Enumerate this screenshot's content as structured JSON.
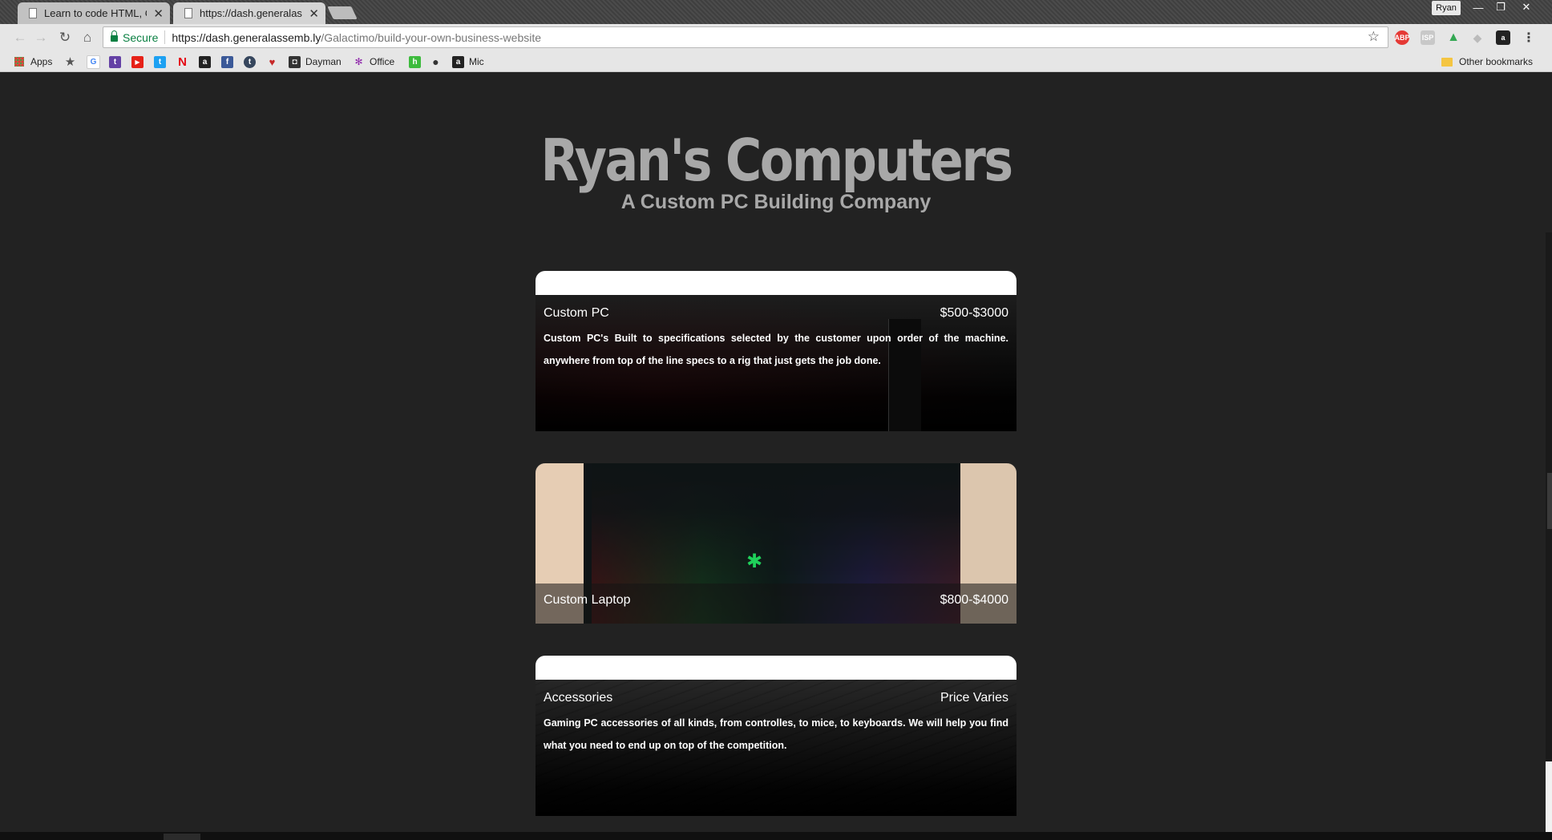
{
  "browser": {
    "tabs": [
      {
        "label": "Learn to code HTML, CSS",
        "active": false
      },
      {
        "label": "https://dash.generalassembly",
        "active": true
      }
    ],
    "user": "Ryan",
    "window_controls": {
      "minimize": "—",
      "maximize": "❐",
      "close": "✕"
    },
    "nav": {
      "back": "←",
      "forward": "→",
      "reload": "↻",
      "home": "⌂"
    },
    "security_label": "Secure",
    "url_host": "https://dash.generalassemb.ly",
    "url_path": "/Galactimo/build-your-own-business-website",
    "bookmark_star": "☆",
    "extensions": [
      "ABP",
      "ISP",
      "▲",
      "◆",
      "a",
      "⋮"
    ],
    "bookmarks": [
      {
        "label": "Apps",
        "icon": "apps-grid-icon"
      },
      {
        "label": "",
        "icon": "star-icon",
        "glyph": "★",
        "color": "#555555"
      },
      {
        "label": "",
        "icon": "google-icon",
        "glyph": "G",
        "color": "#4285f4"
      },
      {
        "label": "",
        "icon": "twitch-icon",
        "glyph": "t",
        "color": "#6441a5"
      },
      {
        "label": "",
        "icon": "youtube-icon",
        "glyph": "▶",
        "color": "#e62117"
      },
      {
        "label": "",
        "icon": "twitter-icon",
        "glyph": "t",
        "color": "#1da1f2"
      },
      {
        "label": "",
        "icon": "netflix-icon",
        "glyph": "N",
        "color": "#e50914"
      },
      {
        "label": "",
        "icon": "amazon-icon",
        "glyph": "a",
        "color": "#222222"
      },
      {
        "label": "",
        "icon": "facebook-icon",
        "glyph": "f",
        "color": "#3b5998"
      },
      {
        "label": "",
        "icon": "tumblr-icon",
        "glyph": "t",
        "color": "#36465d"
      },
      {
        "label": "",
        "icon": "lips-icon",
        "glyph": "♥",
        "color": "#c62828"
      },
      {
        "label": "Dayman",
        "icon": "dayman-icon",
        "glyph": "◘",
        "color": "#333333"
      },
      {
        "label": "Office",
        "icon": "nbc-icon",
        "glyph": "✻",
        "color": "#8e24aa"
      },
      {
        "label": "",
        "icon": "hulu-icon",
        "glyph": "h",
        "color": "#3dbb3d"
      },
      {
        "label": "",
        "icon": "circle-icon",
        "glyph": "●",
        "color": "#333333"
      },
      {
        "label": "Mic",
        "icon": "mic-icon",
        "glyph": "a",
        "color": "#222222"
      }
    ],
    "other_bookmarks": "Other bookmarks"
  },
  "site": {
    "title": "Ryan's Computers",
    "subtitle": "A Custom PC Building Company"
  },
  "cards": [
    {
      "name": "Custom PC",
      "price": "$500-$3000",
      "description": "Custom PC's Built to specifications selected by the customer upon order of the machine. anywhere from top of the line specs to a rig that just gets the job done."
    },
    {
      "name": "Custom Laptop",
      "price": "$800-$4000"
    },
    {
      "name": "Accessories",
      "price": "Price Varies",
      "description": "Gaming PC accessories of all kinds, from controlles, to mice, to keyboards. We will help you find what you need to end up on top of the competition."
    }
  ]
}
